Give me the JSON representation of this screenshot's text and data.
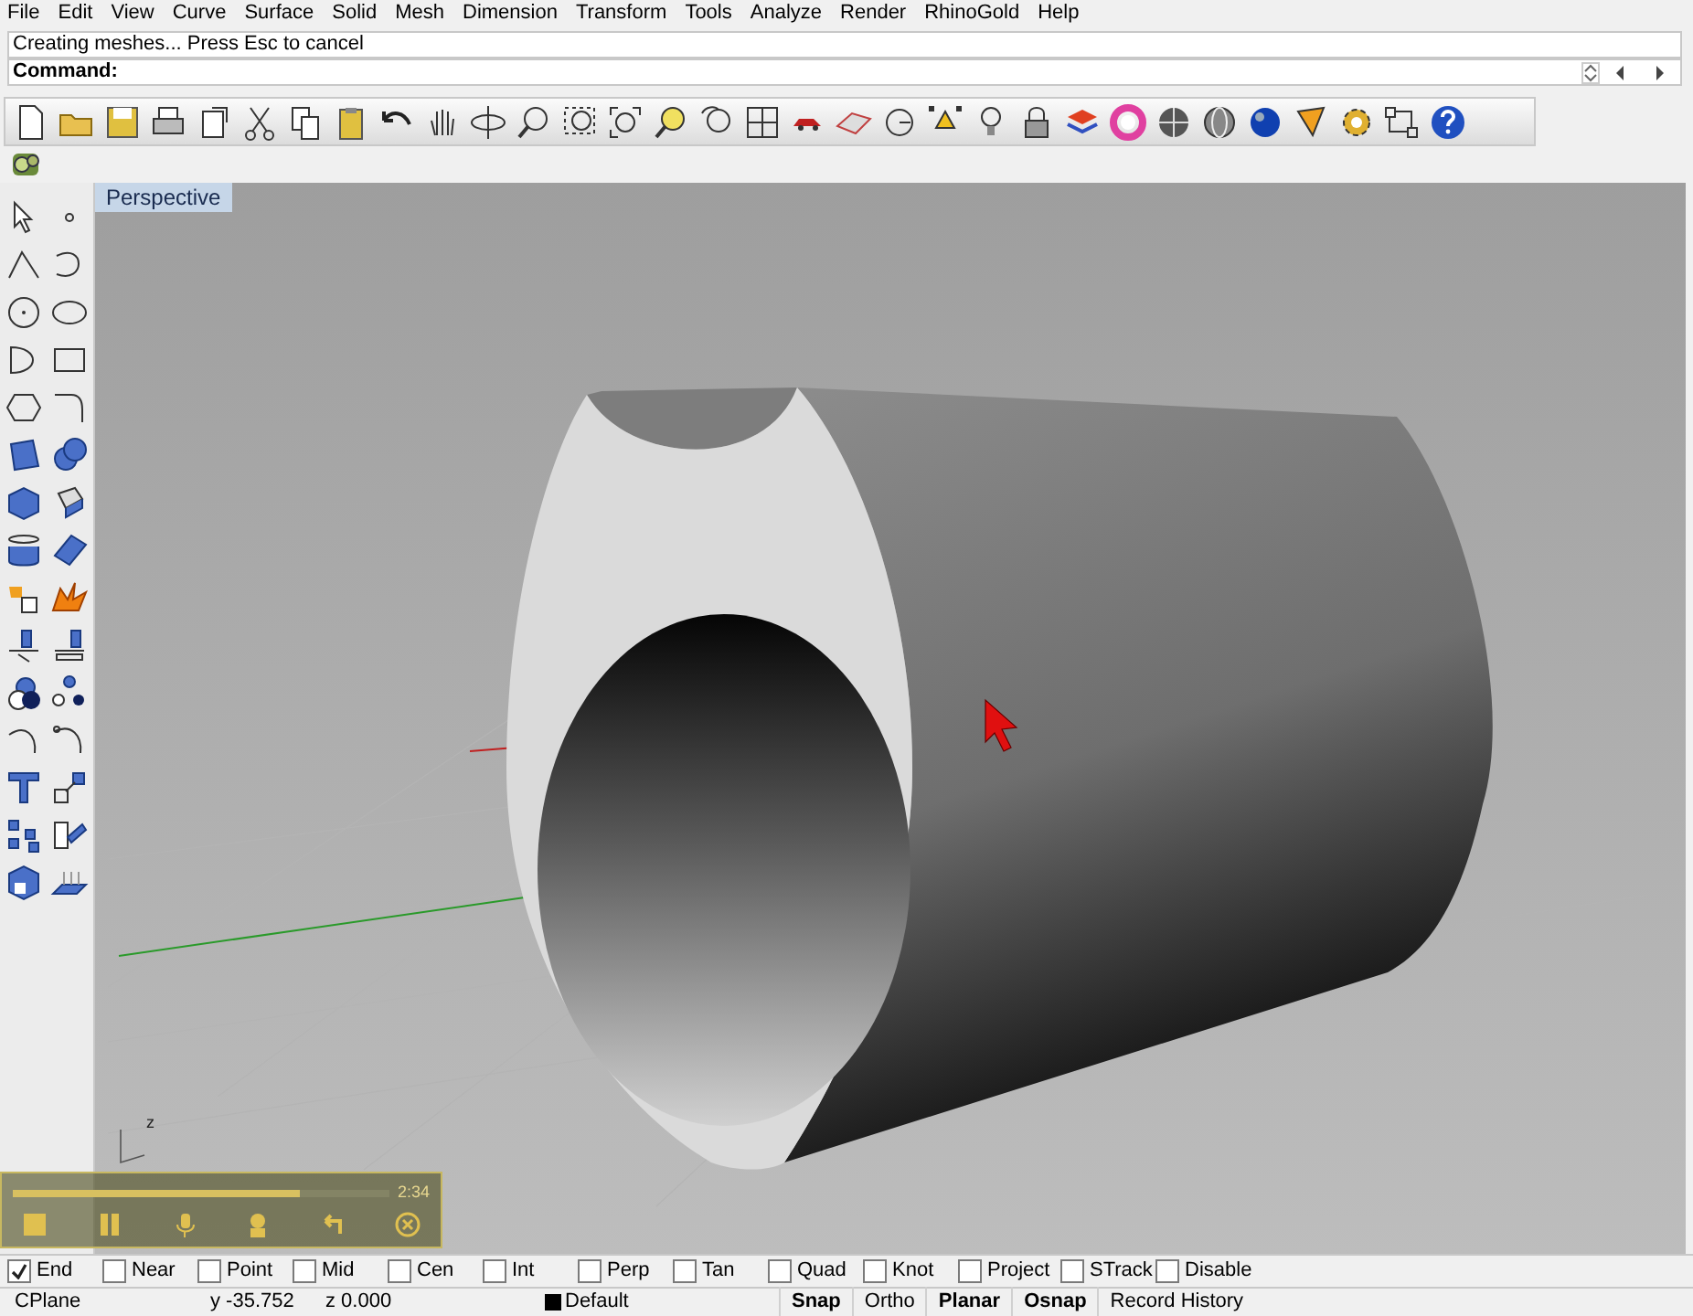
{
  "menu": [
    "File",
    "Edit",
    "View",
    "Curve",
    "Surface",
    "Solid",
    "Mesh",
    "Dimension",
    "Transform",
    "Tools",
    "Analyze",
    "Render",
    "RhinoGold",
    "Help"
  ],
  "command_history": "Creating meshes... Press Esc to cancel",
  "command_label": "Command:",
  "viewport": {
    "title": "Perspective",
    "axis_label": "z"
  },
  "osnaps": [
    {
      "label": "End",
      "checked": true
    },
    {
      "label": "Near",
      "checked": false
    },
    {
      "label": "Point",
      "checked": false
    },
    {
      "label": "Mid",
      "checked": false
    },
    {
      "label": "Cen",
      "checked": false
    },
    {
      "label": "Int",
      "checked": false
    },
    {
      "label": "Perp",
      "checked": false
    },
    {
      "label": "Tan",
      "checked": false
    },
    {
      "label": "Quad",
      "checked": false
    },
    {
      "label": "Knot",
      "checked": false
    },
    {
      "label": "Project",
      "checked": false
    },
    {
      "label": "STrack",
      "checked": false
    },
    {
      "label": "Disable",
      "checked": false
    }
  ],
  "status_bar": {
    "cplane": "CPlane",
    "y": "y -35.752",
    "z": "z 0.000",
    "layer": "Default",
    "toggles": [
      {
        "label": "Snap",
        "on": true
      },
      {
        "label": "Ortho",
        "on": false
      },
      {
        "label": "Planar",
        "on": true
      },
      {
        "label": "Osnap",
        "on": true
      },
      {
        "label": "Record History",
        "on": false
      }
    ]
  },
  "recorder": {
    "time": "2:34",
    "level": 0.76
  }
}
